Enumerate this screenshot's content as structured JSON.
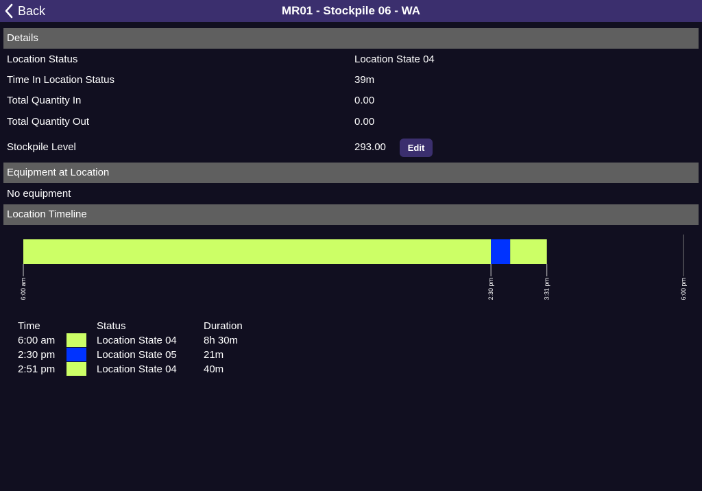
{
  "navbar": {
    "back_label": "Back",
    "title": "MR01 - Stockpile 06 - WA"
  },
  "details": {
    "header": "Details",
    "rows": [
      {
        "label": "Location Status",
        "value": "Location State 04"
      },
      {
        "label": "Time In Location Status",
        "value": "39m"
      },
      {
        "label": "Total Quantity In",
        "value": "0.00"
      },
      {
        "label": "Total Quantity Out",
        "value": "0.00"
      },
      {
        "label": "Stockpile Level",
        "value": "293.00"
      }
    ],
    "edit_label": "Edit"
  },
  "equipment": {
    "header": "Equipment at Location",
    "empty_text": "No equipment"
  },
  "timeline": {
    "header": "Location Timeline",
    "start_minutes": 360,
    "end_minutes": 1080,
    "ticks": [
      {
        "label": "6:00 am",
        "minutes": 360
      },
      {
        "label": "2:30 pm",
        "minutes": 870
      },
      {
        "label": "3:31 pm",
        "minutes": 931
      },
      {
        "label": "6:00 pm",
        "minutes": 1080
      }
    ],
    "segments": [
      {
        "start_minutes": 360,
        "end_minutes": 870,
        "color": "#ccff66"
      },
      {
        "start_minutes": 870,
        "end_minutes": 891,
        "color": "#0033ff"
      },
      {
        "start_minutes": 891,
        "end_minutes": 931,
        "color": "#ccff66"
      }
    ]
  },
  "legend": {
    "headers": {
      "time": "Time",
      "status": "Status",
      "duration": "Duration"
    },
    "rows": [
      {
        "time": "6:00 am",
        "color": "#ccff66",
        "status": "Location State 04",
        "duration": "8h 30m"
      },
      {
        "time": "2:30 pm",
        "color": "#0033ff",
        "status": "Location State 05",
        "duration": "21m"
      },
      {
        "time": "2:51 pm",
        "color": "#ccff66",
        "status": "Location State 04",
        "duration": "40m"
      }
    ]
  },
  "colors": {
    "navbar": "#3b2f6e",
    "background": "#110f20",
    "section_header": "#5f5f5f",
    "state_04": "#ccff66",
    "state_05": "#0033ff"
  },
  "icons": {
    "back": "chevron-left-icon"
  }
}
